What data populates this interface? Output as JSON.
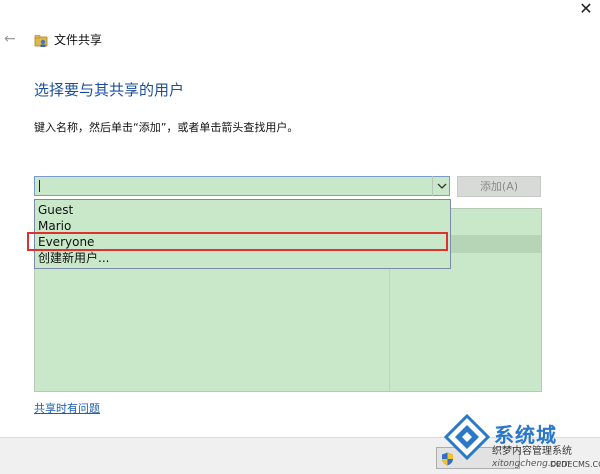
{
  "window": {
    "close_glyph": "✕",
    "back_glyph": "←",
    "title": "文件共享"
  },
  "content": {
    "heading": "选择要与其共享的用户",
    "instruction": "键入名称，然后单击“添加”，或者单击箭头查找用户。"
  },
  "combo": {
    "value": "",
    "arrow_icon": "chevron-down-icon"
  },
  "add_button": {
    "label": "添加(A)"
  },
  "dropdown": {
    "options": [
      "Guest",
      "Mario",
      "Everyone",
      "创建新用户..."
    ],
    "highlighted": "Everyone"
  },
  "help_link": {
    "label": "共享时有问题"
  },
  "watermark": {
    "name": "系统城",
    "sub": "织梦内容管理系统",
    "url": "xitongcheng.com",
    "site": "DEDECMS.COM"
  },
  "colors": {
    "heading_blue": "#1b4f9c",
    "link_blue": "#1a5fb4",
    "list_green": "#c9e8c9",
    "highlight_red": "#e03030"
  }
}
